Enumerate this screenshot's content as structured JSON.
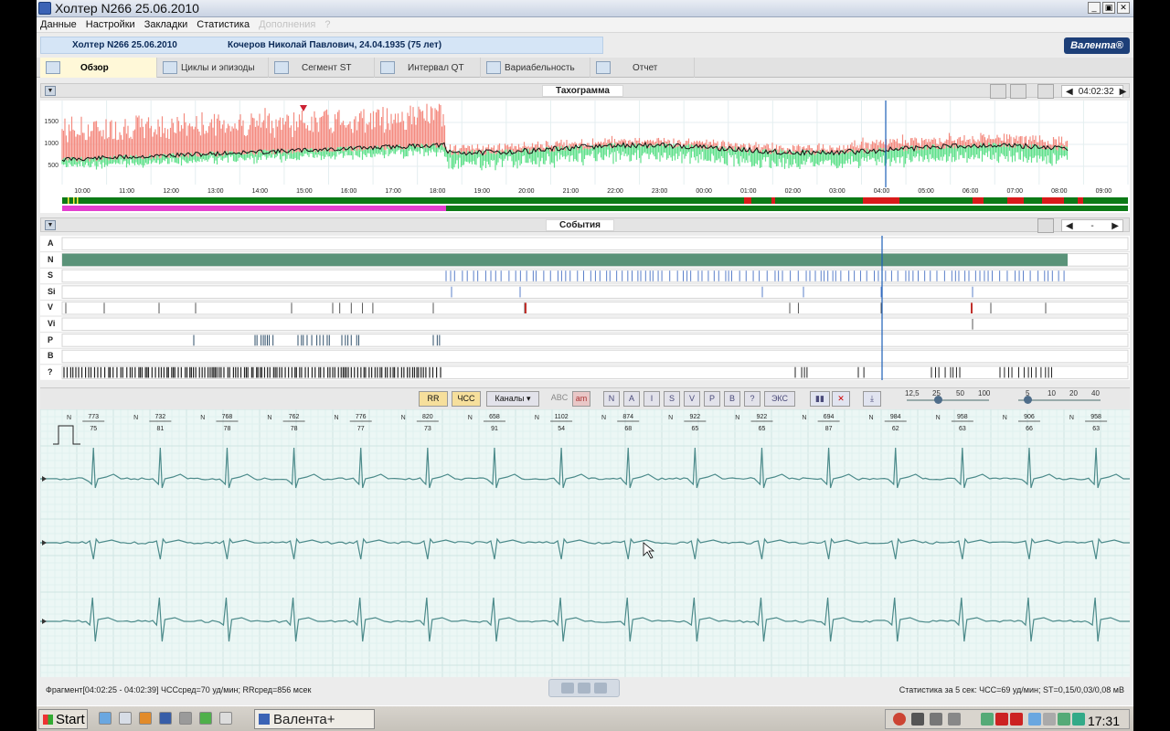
{
  "window": {
    "title": "Холтер N266  25.06.2010",
    "controls": [
      "_",
      "▣",
      "✕"
    ]
  },
  "menu": {
    "items": [
      "Данные",
      "Настройки",
      "Закладки",
      "Статистика"
    ],
    "disabled": "Дополнения",
    "help": "?"
  },
  "header": {
    "record": "Холтер  N266  25.06.2010",
    "patient": "Кочеров Николай Павлович, 24.04.1935 (75 лет)",
    "logo": "Валента®"
  },
  "tabs": [
    {
      "label": "Обзор",
      "active": true
    },
    {
      "label": "Циклы и эпизоды",
      "active": false
    },
    {
      "label": "Сегмент ST",
      "active": false
    },
    {
      "label": "Интервал QT",
      "active": false
    },
    {
      "label": "Вариабельность",
      "active": false
    },
    {
      "label": "Отчет",
      "active": false
    }
  ],
  "tachogram": {
    "title": "Тахограмма",
    "time_readout": "04:02:32",
    "yticks": [
      "1500",
      "1000",
      "500"
    ],
    "hours": [
      "10:00",
      "11:00",
      "12:00",
      "13:00",
      "14:00",
      "15:00",
      "16:00",
      "17:00",
      "18:00",
      "19:00",
      "20:00",
      "21:00",
      "22:00",
      "23:00",
      "00:00",
      "01:00",
      "02:00",
      "03:00",
      "04:00",
      "05:00",
      "06:00",
      "07:00",
      "08:00",
      "09:00"
    ],
    "colors": {
      "max": "#f48b80",
      "mean": "#111111",
      "min": "#5fe08a",
      "cursor": "#1c5fb8",
      "strip": "#0c7a16",
      "strip_alt": "#d81a1a",
      "pink": "#e23fcf"
    }
  },
  "events": {
    "title": "События",
    "nav": "-",
    "rows": [
      "A",
      "N",
      "S",
      "Si",
      "V",
      "Vi",
      "P",
      "B",
      "?"
    ],
    "colors": {
      "N": "#5a9379",
      "S": "#5a7fc9",
      "V": "#555555",
      "Vred": "#c0302b",
      "P": "#2f4f6a",
      "Q": "#222222"
    }
  },
  "ecg_toolbar": {
    "rr": "RR",
    "hr": "ЧСС",
    "channels": "Каналы",
    "abc": "ABC",
    "am": "am",
    "labels": [
      "N",
      "A",
      "I",
      "S",
      "V",
      "P",
      "B",
      "?",
      "ЭКС"
    ],
    "speed_ticks": [
      "12,5",
      "25",
      "50",
      "100"
    ],
    "gain_ticks": [
      "5",
      "10",
      "20",
      "40"
    ]
  },
  "ecg_strip": {
    "beats": [
      {
        "type": "N",
        "rr": "773",
        "hr": "75"
      },
      {
        "type": "N",
        "rr": "732",
        "hr": "81"
      },
      {
        "type": "N",
        "rr": "768",
        "hr": "78"
      },
      {
        "type": "N",
        "rr": "762",
        "hr": "78"
      },
      {
        "type": "N",
        "rr": "776",
        "hr": "77"
      },
      {
        "type": "N",
        "rr": "820",
        "hr": "73"
      },
      {
        "type": "N",
        "rr": "658",
        "hr": "91"
      },
      {
        "type": "N",
        "rr": "1102",
        "hr": "54"
      },
      {
        "type": "N",
        "rr": "874",
        "hr": "68"
      },
      {
        "type": "N",
        "rr": "922",
        "hr": "65"
      },
      {
        "type": "N",
        "rr": "922",
        "hr": "65"
      },
      {
        "type": "N",
        "rr": "694",
        "hr": "87"
      },
      {
        "type": "N",
        "rr": "984",
        "hr": "62"
      },
      {
        "type": "N",
        "rr": "958",
        "hr": "63"
      },
      {
        "type": "N",
        "rr": "906",
        "hr": "66"
      },
      {
        "type": "N",
        "rr": "958",
        "hr": "63"
      }
    ]
  },
  "status": {
    "left": "Фрагмент[04:02:25 - 04:02:39]  ЧССсред=70 уд/мин;  RRсред=856 мсек",
    "right": "Статистика за 5 сек:  ЧСС=69 уд/мин; ST=0,15/0,03/0,08 мВ"
  },
  "taskbar": {
    "start": "Start",
    "task": "Валента+",
    "clock": "17:31"
  }
}
